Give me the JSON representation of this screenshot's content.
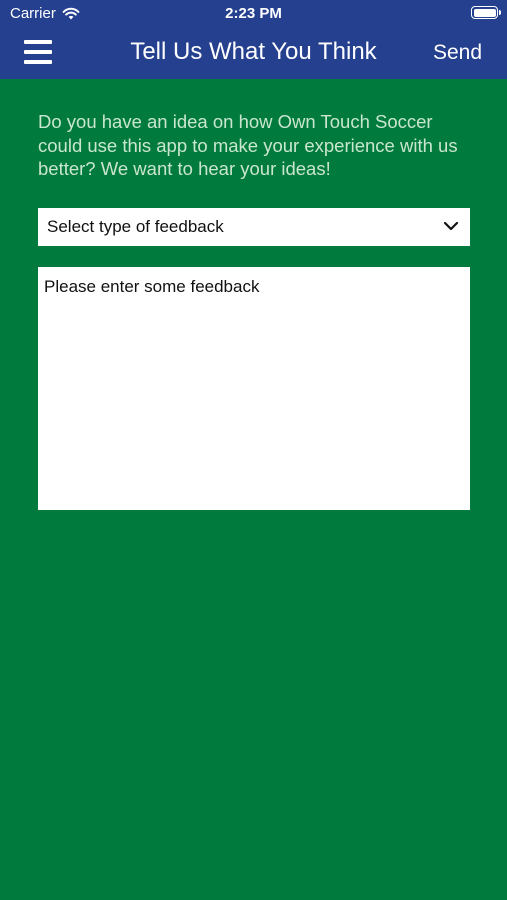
{
  "status_bar": {
    "carrier": "Carrier",
    "time": "2:23 PM"
  },
  "nav": {
    "title": "Tell Us What You Think",
    "send_label": "Send",
    "menu_icon": "hamburger-menu-icon"
  },
  "intro_text": "Do you have an idea on how Own Touch Soccer could use this app to make your experience with us better? We want to hear your ideas!",
  "feedback_type": {
    "selected": "Select type of feedback",
    "icon": "chevron-down-icon"
  },
  "feedback_field": {
    "placeholder": "Please enter some feedback"
  },
  "colors": {
    "nav_background": "#25408f",
    "page_background": "#007a3d",
    "intro_text": "#c9e6cf"
  }
}
